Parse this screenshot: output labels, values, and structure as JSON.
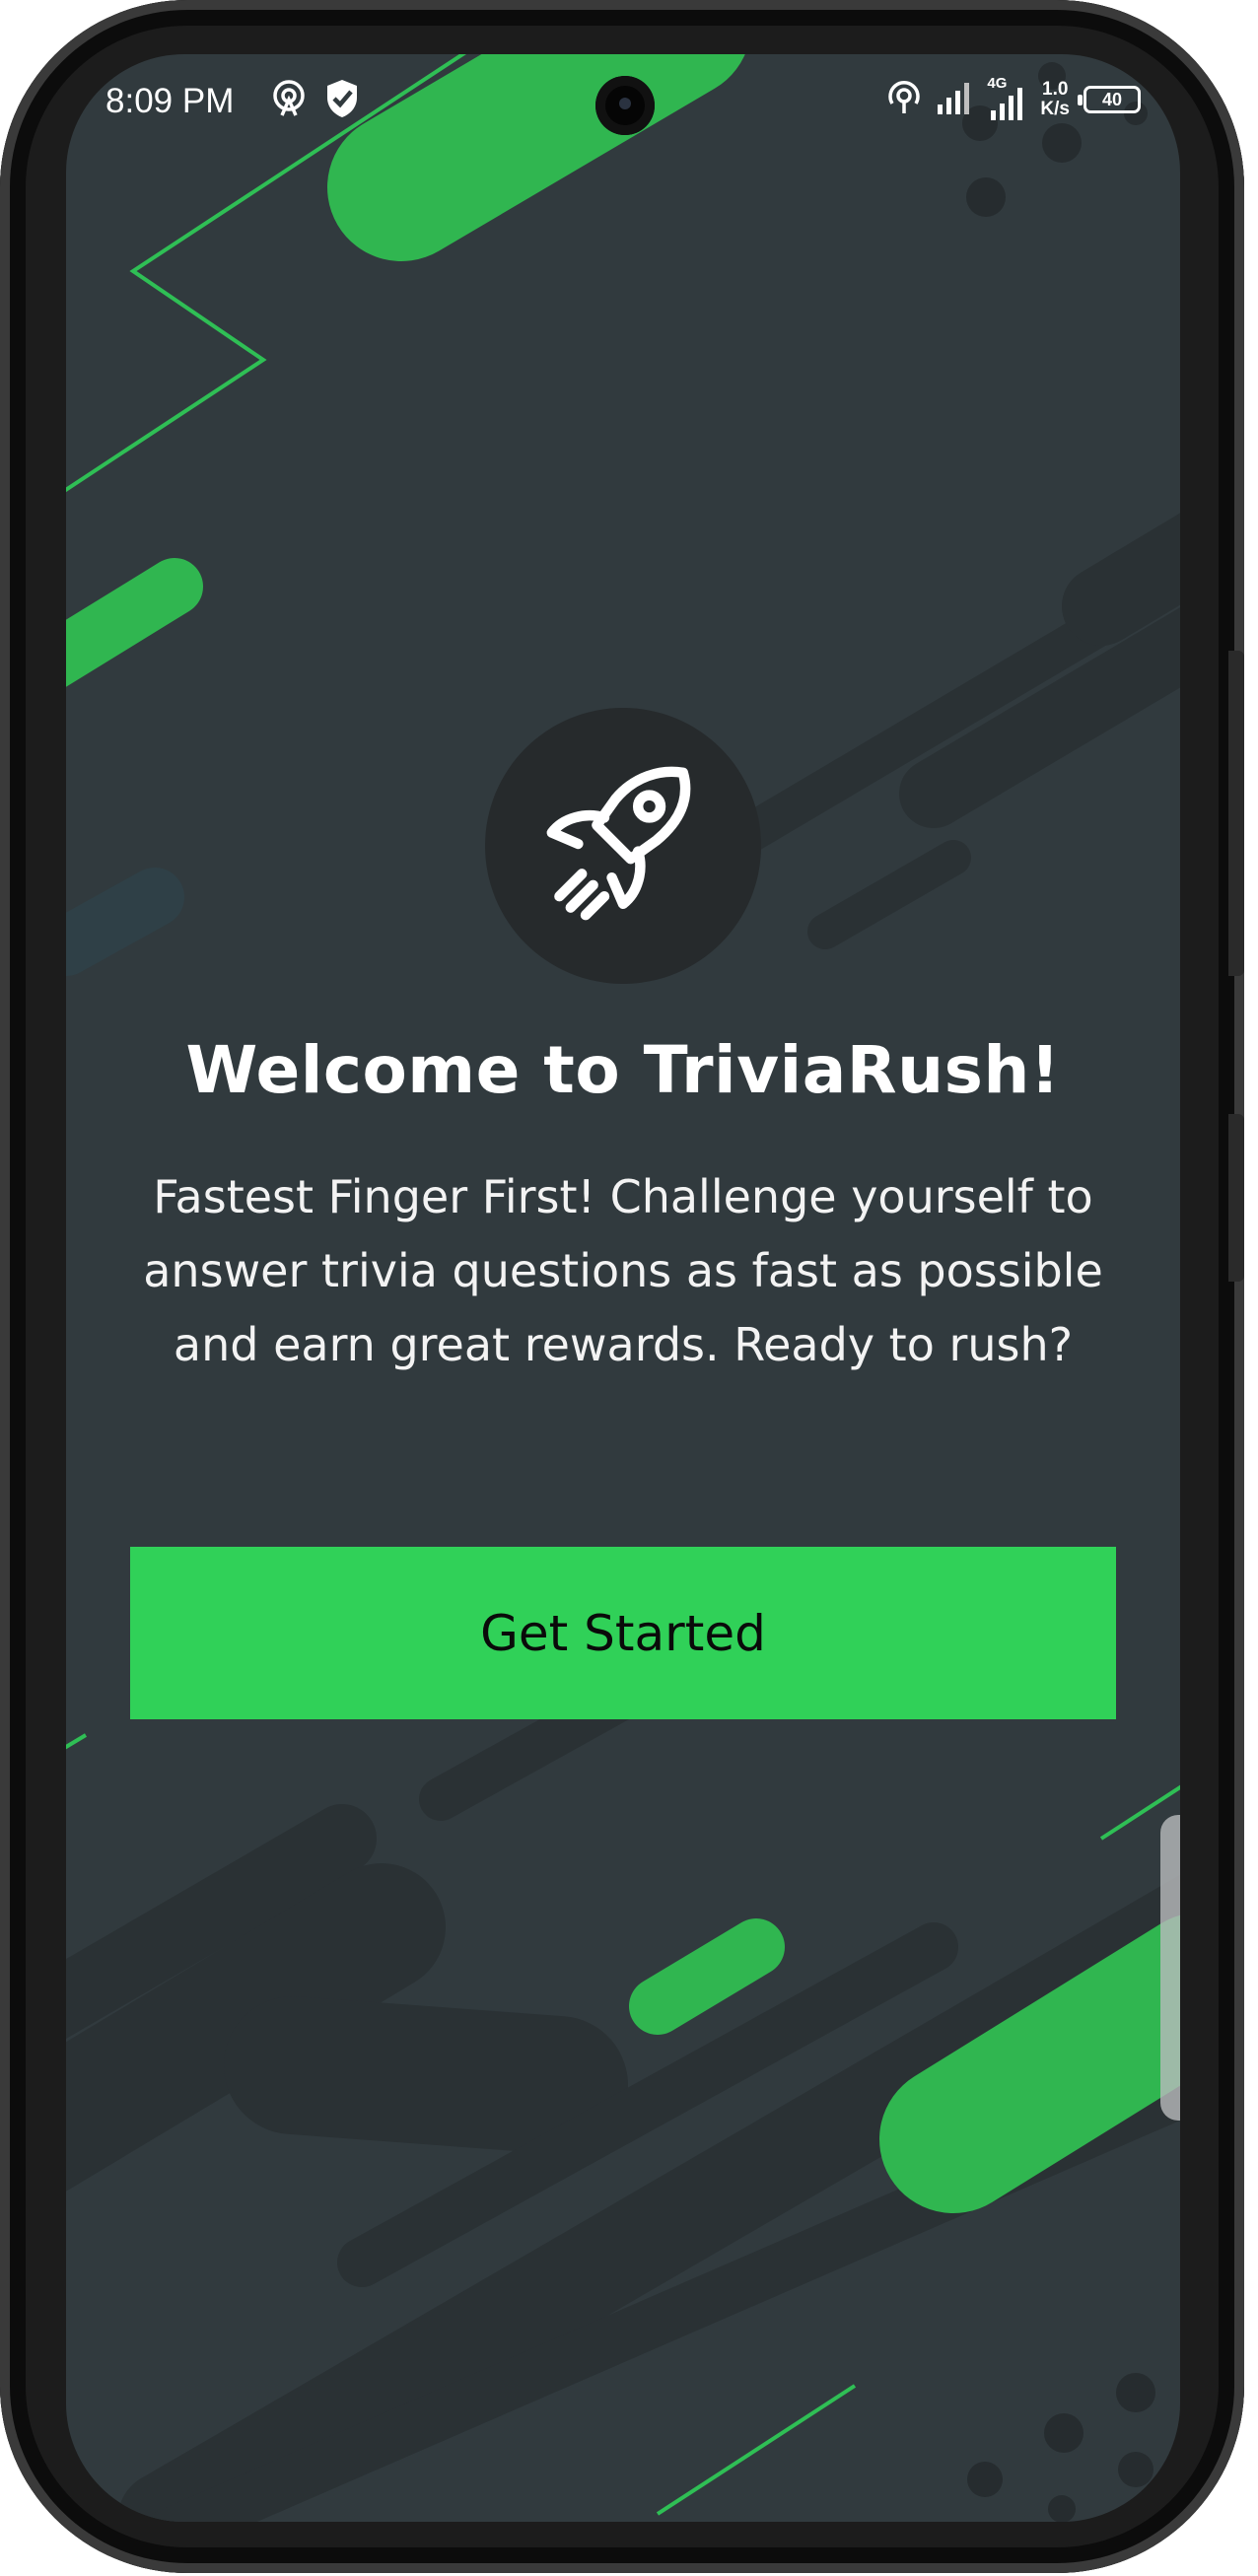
{
  "status_bar": {
    "time": "8:09 PM",
    "network_type": "4G",
    "speed_value": "1.0",
    "speed_unit": "K/s",
    "battery_level": "40",
    "icons": [
      "hotspot-icon",
      "shield-check-icon",
      "hotspot-icon",
      "signal-icon",
      "signal-4g-icon"
    ]
  },
  "welcome": {
    "icon": "rocket-icon",
    "title": "Welcome to TriviaRush!",
    "description": "Fastest Finger First! Challenge yourself to answer trivia questions as fast as possible and earn great rewards. Ready to rush?",
    "button_label": "Get Started"
  },
  "colors": {
    "background": "#313a3e",
    "accent": "#30d158",
    "icon_circle": "#262a2c",
    "text": "#ffffff"
  }
}
